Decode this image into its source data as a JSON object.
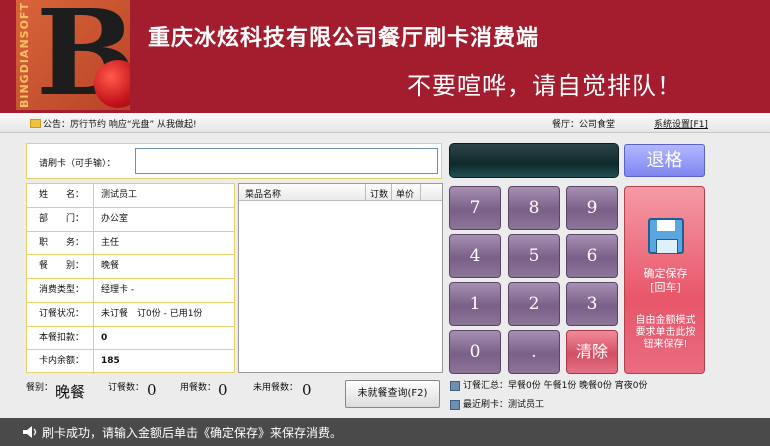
{
  "header": {
    "logo_text": "BINGDIANSOFT",
    "title": "重庆冰炫科技有限公司餐厅刷卡消费端",
    "slogan": "不要喧哗，请自觉排队！"
  },
  "notice": {
    "announcement": "公告：厉行节约 响应“光盘” 从我做起!",
    "restaurant": "餐厅：公司食堂",
    "settings_label": "系统设置[F1]"
  },
  "card": {
    "label": "请刷卡（可手输）：",
    "value": ""
  },
  "info": [
    {
      "key": "姓　　名：",
      "value": "测试员工",
      "bold": false
    },
    {
      "key": "部　　门：",
      "value": "办公室",
      "bold": false
    },
    {
      "key": "职　　务：",
      "value": "主任",
      "bold": false
    },
    {
      "key": "餐　　别：",
      "value": "晚餐",
      "bold": false
    },
    {
      "key": "消费类型：",
      "value": "经理卡 -",
      "bold": false
    },
    {
      "key": "订餐状况：",
      "value": "未订餐　订0份 - 已用1份",
      "bold": false
    },
    {
      "key": "本餐扣款：",
      "value": "0",
      "bold": true
    },
    {
      "key": "卡内余额：",
      "value": "185",
      "bold": true
    }
  ],
  "dishes": {
    "col_name": "菜品名称",
    "col_count": "订数",
    "col_price": "单价"
  },
  "stats": {
    "meal_label": "餐别：",
    "meal_value": "晚餐",
    "ordered_label": "订餐数：",
    "ordered_value": "0",
    "used_label": "用餐数：",
    "used_value": "0",
    "unused_label": "未用餐数：",
    "unused_value": "0",
    "not_meal_button": "未就餐查询(F2)",
    "summary": "订餐汇总：早餐0份 午餐1份 晚餐0份 宵夜0份",
    "recent": "最近刷卡：测试员工"
  },
  "controls": {
    "back_label": "退格",
    "keys": [
      "7",
      "8",
      "9",
      "4",
      "5",
      "6",
      "1",
      "2",
      "3",
      "0",
      "."
    ],
    "clear_label": "清除",
    "save_label": "确定保存",
    "save_hint": "[回车]",
    "save_note": "自由金额模式要求单击此按钮来保存!"
  },
  "status": {
    "message": "刷卡成功，请输入金额后单击《确定保存》来保存消费。"
  },
  "colors": {
    "header_bg": "#a31d2e",
    "keypad": "#7a5f88",
    "save_button": "#e8566a",
    "back_button": "#7f86ef",
    "status_bg": "#4a4a4a"
  }
}
